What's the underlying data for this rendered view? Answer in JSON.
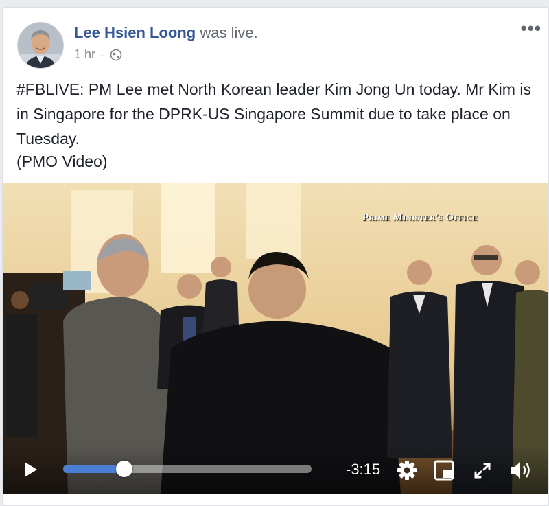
{
  "post": {
    "author": "Lee Hsien Loong",
    "action": "was live.",
    "timestamp": "1 hr",
    "separator": "·",
    "privacy_icon": "globe-icon",
    "more_icon": "more-options-icon",
    "more_label": "•••",
    "message": "#FBLIVE: PM Lee met North Korean leader Kim Jong Un today. Mr Kim is in Singapore for the DPRK-US Singapore Summit due to take place on Tuesday.",
    "credit": "(PMO Video)"
  },
  "video": {
    "watermark": "Prime Minister's Office",
    "time_remaining": "-3:15",
    "progress_fraction": 0.245,
    "buffered_fraction": 0.27,
    "controls": {
      "play_icon": "play-icon",
      "settings_icon": "gear-icon",
      "pip_icon": "picture-in-picture-icon",
      "fullscreen_icon": "fullscreen-icon",
      "volume_icon": "volume-icon"
    }
  },
  "colors": {
    "author_link": "#365899",
    "progress_fill": "#4a7fd4",
    "text": "#1d2129",
    "meta": "#7f8389"
  }
}
